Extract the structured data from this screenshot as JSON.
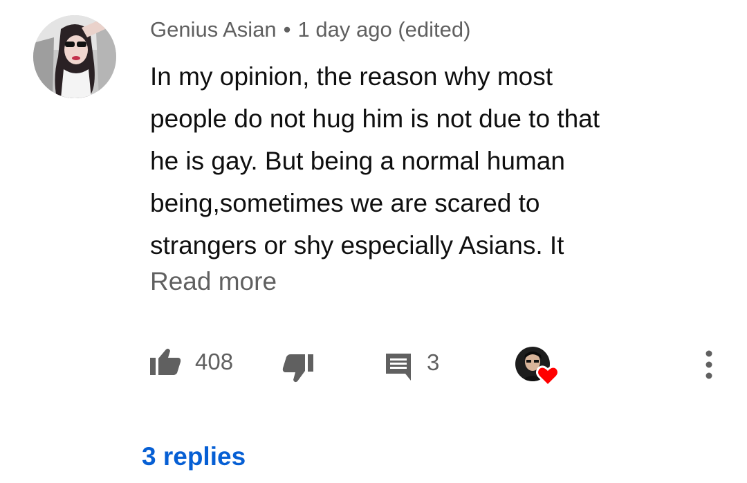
{
  "comment": {
    "author": "Genius Asian",
    "separator": "•",
    "time": "1 day ago (edited)",
    "lines": [
      "In my opinion, the reason why most",
      "people do not hug him is not due to that",
      "he is gay. But being a normal human",
      "being,sometimes we are scared to",
      "strangers or shy especially Asians. It"
    ],
    "read_more": "Read more"
  },
  "actions": {
    "like_icon": "thumbs-up-icon",
    "like_count": "408",
    "dislike_icon": "thumbs-down-icon",
    "reply_icon": "comment-icon",
    "reply_count": "3",
    "creator_heart_icon": "heart-icon",
    "more_icon": "more-vertical-icon"
  },
  "replies_link": "3 replies",
  "colors": {
    "text": "#0f0f0f",
    "secondary": "#606060",
    "link": "#065fd4",
    "heart": "#ff0000"
  }
}
